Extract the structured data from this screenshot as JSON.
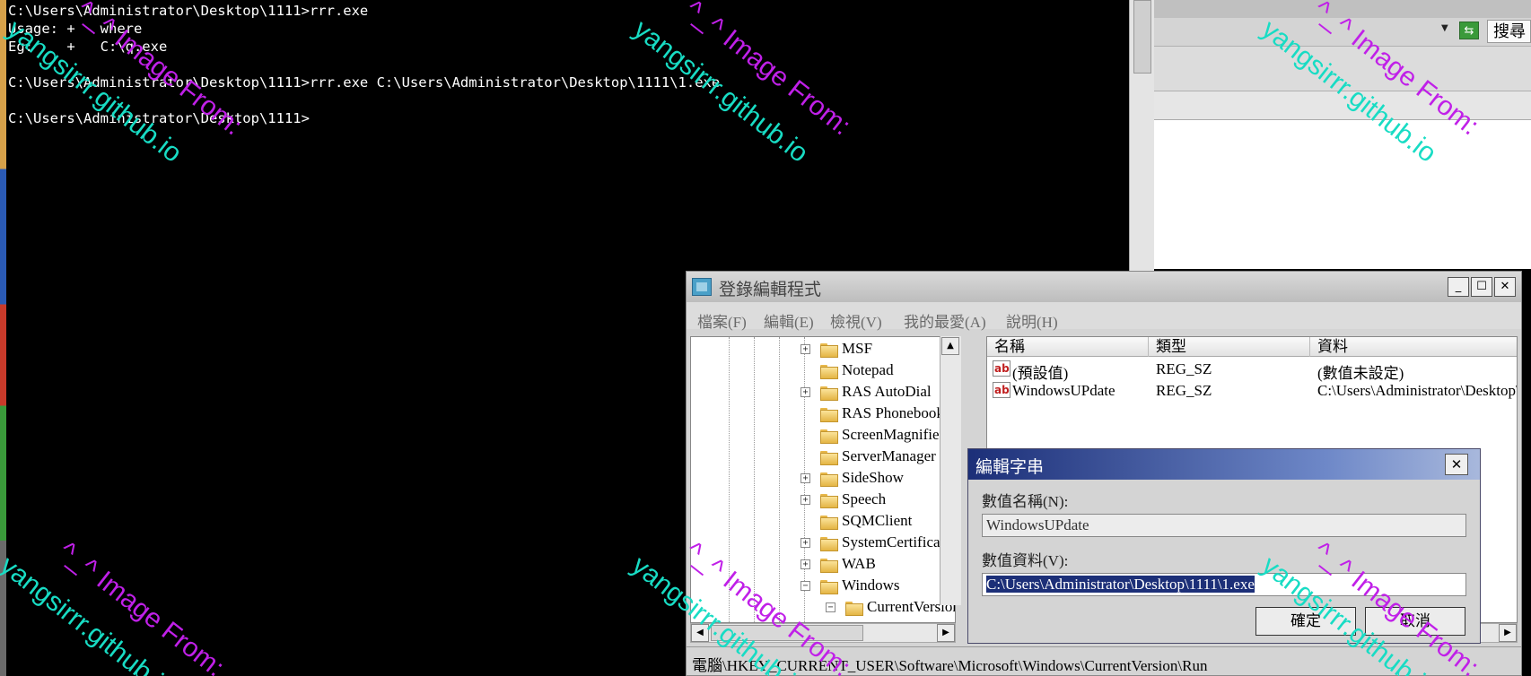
{
  "console": {
    "lines": [
      "C:\\Users\\Administrator\\Desktop\\1111>rrr.exe",
      "Usage: +   where",
      "Eg:    +   C:\\q.exe",
      "",
      "C:\\Users\\Administrator\\Desktop\\1111>rrr.exe C:\\Users\\Administrator\\Desktop\\1111\\1.exe",
      "",
      "C:\\Users\\Administrator\\Desktop\\1111>"
    ]
  },
  "browser": {
    "search_label": "搜尋",
    "refresh_icon": "refresh-icon"
  },
  "regedit": {
    "title": "登錄編輯程式",
    "menu": [
      "檔案(F)",
      "編輯(E)",
      "檢視(V)",
      "我的最愛(A)",
      "說明(H)"
    ],
    "tree_items": [
      {
        "label": "MSF",
        "expandable": true
      },
      {
        "label": "Notepad",
        "expandable": false
      },
      {
        "label": "RAS AutoDial",
        "expandable": true
      },
      {
        "label": "RAS Phonebook",
        "expandable": false
      },
      {
        "label": "ScreenMagnifier",
        "expandable": false
      },
      {
        "label": "ServerManager",
        "expandable": false
      },
      {
        "label": "SideShow",
        "expandable": true
      },
      {
        "label": "Speech",
        "expandable": true
      },
      {
        "label": "SQMClient",
        "expandable": false
      },
      {
        "label": "SystemCertificates",
        "expandable": true
      },
      {
        "label": "WAB",
        "expandable": true
      },
      {
        "label": "Windows",
        "expandable": true,
        "expanded": true
      },
      {
        "label": "CurrentVersion",
        "expandable": true,
        "expanded": true
      }
    ],
    "columns": [
      "名稱",
      "類型",
      "資料"
    ],
    "values": [
      {
        "name": "(預設值)",
        "type": "REG_SZ",
        "data": "(數值未設定)"
      },
      {
        "name": "WindowsUPdate",
        "type": "REG_SZ",
        "data": "C:\\Users\\Administrator\\Desktop\\"
      }
    ],
    "status_path": "電腦\\HKEY_CURRENT_USER\\Software\\Microsoft\\Windows\\CurrentVersion\\Run"
  },
  "edit_dialog": {
    "title": "編輯字串",
    "name_label": "數值名稱(N):",
    "name_value": "WindowsUPdate",
    "data_label": "數值資料(V):",
    "data_value": "C:\\Users\\Administrator\\Desktop\\1111\\1.exe",
    "ok_label": "確定",
    "cancel_label": "取消"
  },
  "watermark": {
    "line1": "^_^ Image From:",
    "line2": "yangsirrr.github.io"
  },
  "colors": {
    "watermark_cyan": "#18dcc4",
    "watermark_magenta": "#c020e8",
    "dialog_title_blue": "#1c2f78"
  }
}
